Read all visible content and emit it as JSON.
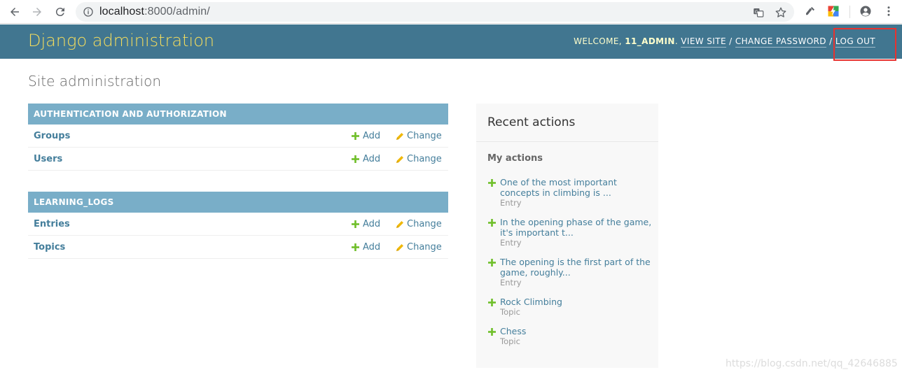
{
  "browser": {
    "url_host": "localhost",
    "url_rest": ":8000/admin/"
  },
  "header": {
    "branding": "Django administration",
    "welcome": "WELCOME, ",
    "username": "11_ADMIN",
    "period": ". ",
    "view_site": "VIEW SITE",
    "sep1": " / ",
    "change_password": "CHANGE PASSWORD",
    "sep2": " / ",
    "log_out": "LOG OUT"
  },
  "page_title": "Site administration",
  "modules": [
    {
      "caption": "AUTHENTICATION AND AUTHORIZATION",
      "rows": [
        {
          "name": "Groups",
          "add": "Add",
          "change": "Change"
        },
        {
          "name": "Users",
          "add": "Add",
          "change": "Change"
        }
      ]
    },
    {
      "caption": "LEARNING_LOGS",
      "rows": [
        {
          "name": "Entries",
          "add": "Add",
          "change": "Change"
        },
        {
          "name": "Topics",
          "add": "Add",
          "change": "Change"
        }
      ]
    }
  ],
  "recent": {
    "title": "Recent actions",
    "subtitle": "My actions",
    "actions": [
      {
        "text": "One of the most important concepts in climbing is ...",
        "type": "Entry"
      },
      {
        "text": "In the opening phase of the game, it's important t...",
        "type": "Entry"
      },
      {
        "text": "The opening is the first part of the game, roughly...",
        "type": "Entry"
      },
      {
        "text": "Rock Climbing",
        "type": "Topic"
      },
      {
        "text": "Chess",
        "type": "Topic"
      }
    ]
  },
  "watermark": "https://blog.csdn.net/qq_42646885",
  "colors": {
    "header_bg": "#417690",
    "branding": "#f5dd5d",
    "caption_bg": "#79aec8",
    "link": "#447e9b",
    "add_green": "#70bf2b",
    "change_yellow": "#efb80b",
    "highlight_red": "#e8322f"
  },
  "icons": {
    "back": "back-arrow-icon",
    "forward": "forward-arrow-icon",
    "reload": "reload-icon",
    "info": "info-icon",
    "translate": "translate-icon",
    "bookmark": "star-icon",
    "account": "account-icon",
    "menu": "kebab-menu-icon",
    "add": "plus-icon",
    "change": "pencil-icon"
  }
}
